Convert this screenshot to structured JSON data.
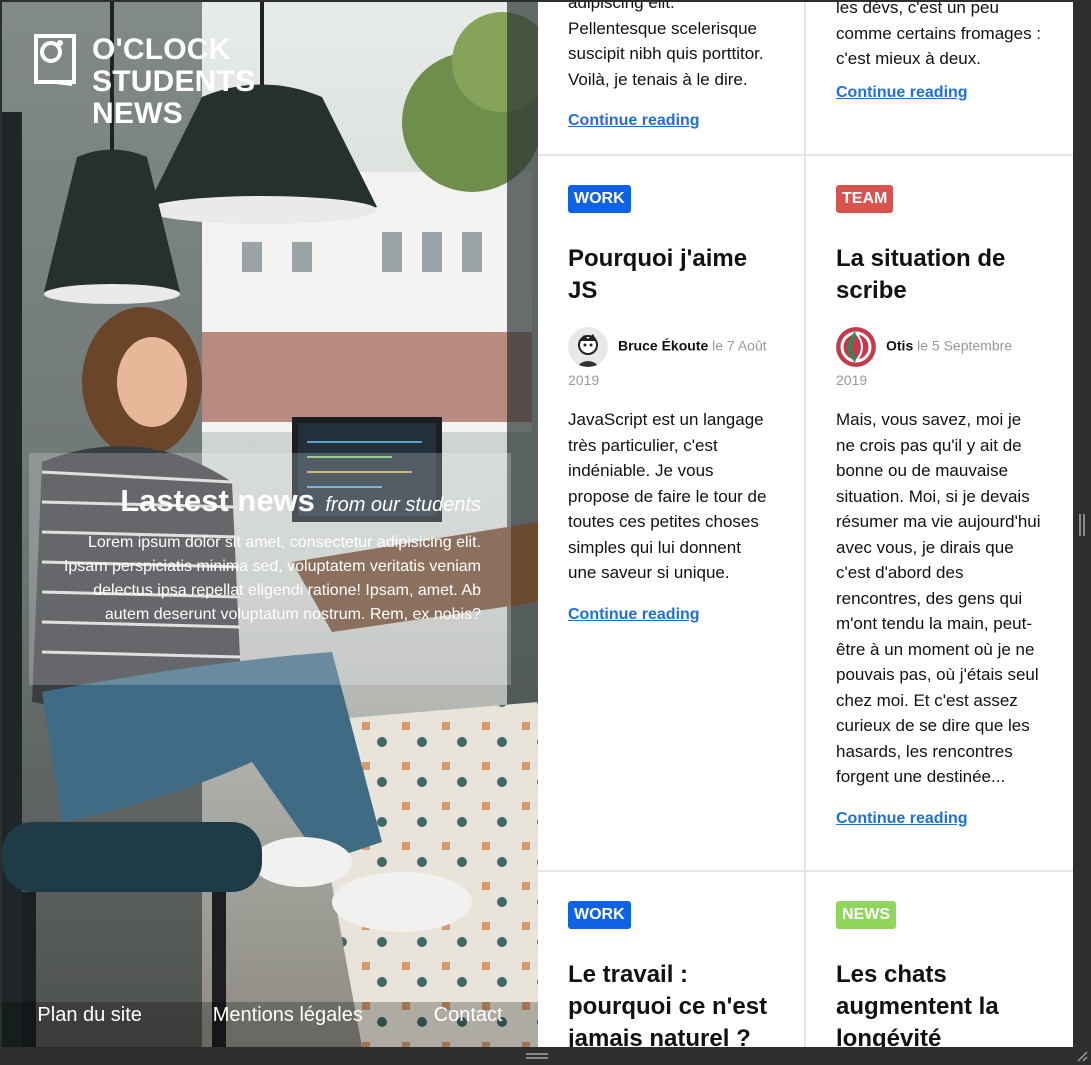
{
  "hero": {
    "logo_lines": [
      "O'CLOCK",
      "STUDENTS",
      "NEWS"
    ],
    "news_title": "Lastest news",
    "news_subtitle": "from our students",
    "news_text": "Lorem ipsum dolor sit amet, consectetur adipisicing elit. Ipsam perspiciatis minima sed, voluptatem veritatis veniam delectus ipsa repellat eligendi ratione! Ipsam, amet. Ab autem deserunt voluptatum nostrum. Rem, ex nobis?",
    "footer": [
      "Plan du site",
      "Mentions légales",
      "Contact"
    ]
  },
  "articles": [
    {
      "excerpt": "adipiscing elit. Pellentesque scelerisque suscipit nibh quis porttitor. Voilà, je tenais à le dire.",
      "more": "Continue reading"
    },
    {
      "excerpt": "les dévs, c'est un peu comme certains fromages : c'est mieux à deux.",
      "more": "Continue reading"
    },
    {
      "tag": "WORK",
      "title": "Pourquoi j'aime JS",
      "author": "Bruce Ékoute",
      "date": "le 7 Août 2019",
      "excerpt": "JavaScript est un langage très particulier, c'est indéniable. Je vous propose de faire le tour de toutes ces petites choses simples qui lui donnent une saveur si unique.",
      "more": "Continue reading"
    },
    {
      "tag": "TEAM",
      "title": "La situation de scribe",
      "author": "Otis",
      "date": "le 5 Septembre 2019",
      "excerpt": "Mais, vous savez, moi je ne crois pas qu'il y ait de bonne ou de mauvaise situation. Moi, si je devais résumer ma vie aujourd'hui avec vous, je dirais que c'est d'abord des rencontres, des gens qui m'ont tendu la main, peut-être à un moment où je ne pouvais pas, où j'étais seul chez moi. Et c'est assez curieux de se dire que les hasards, les rencontres forgent une destinée...",
      "more": "Continue reading"
    },
    {
      "tag": "WORK",
      "title": "Le travail : pourquoi ce n'est jamais naturel ?"
    },
    {
      "tag": "NEWS",
      "title": "Les chats augmentent la longévité"
    }
  ],
  "colors": {
    "work": "#1062e5",
    "team": "#d9534f",
    "news": "#8fd65a",
    "link": "#1e6fd9"
  }
}
